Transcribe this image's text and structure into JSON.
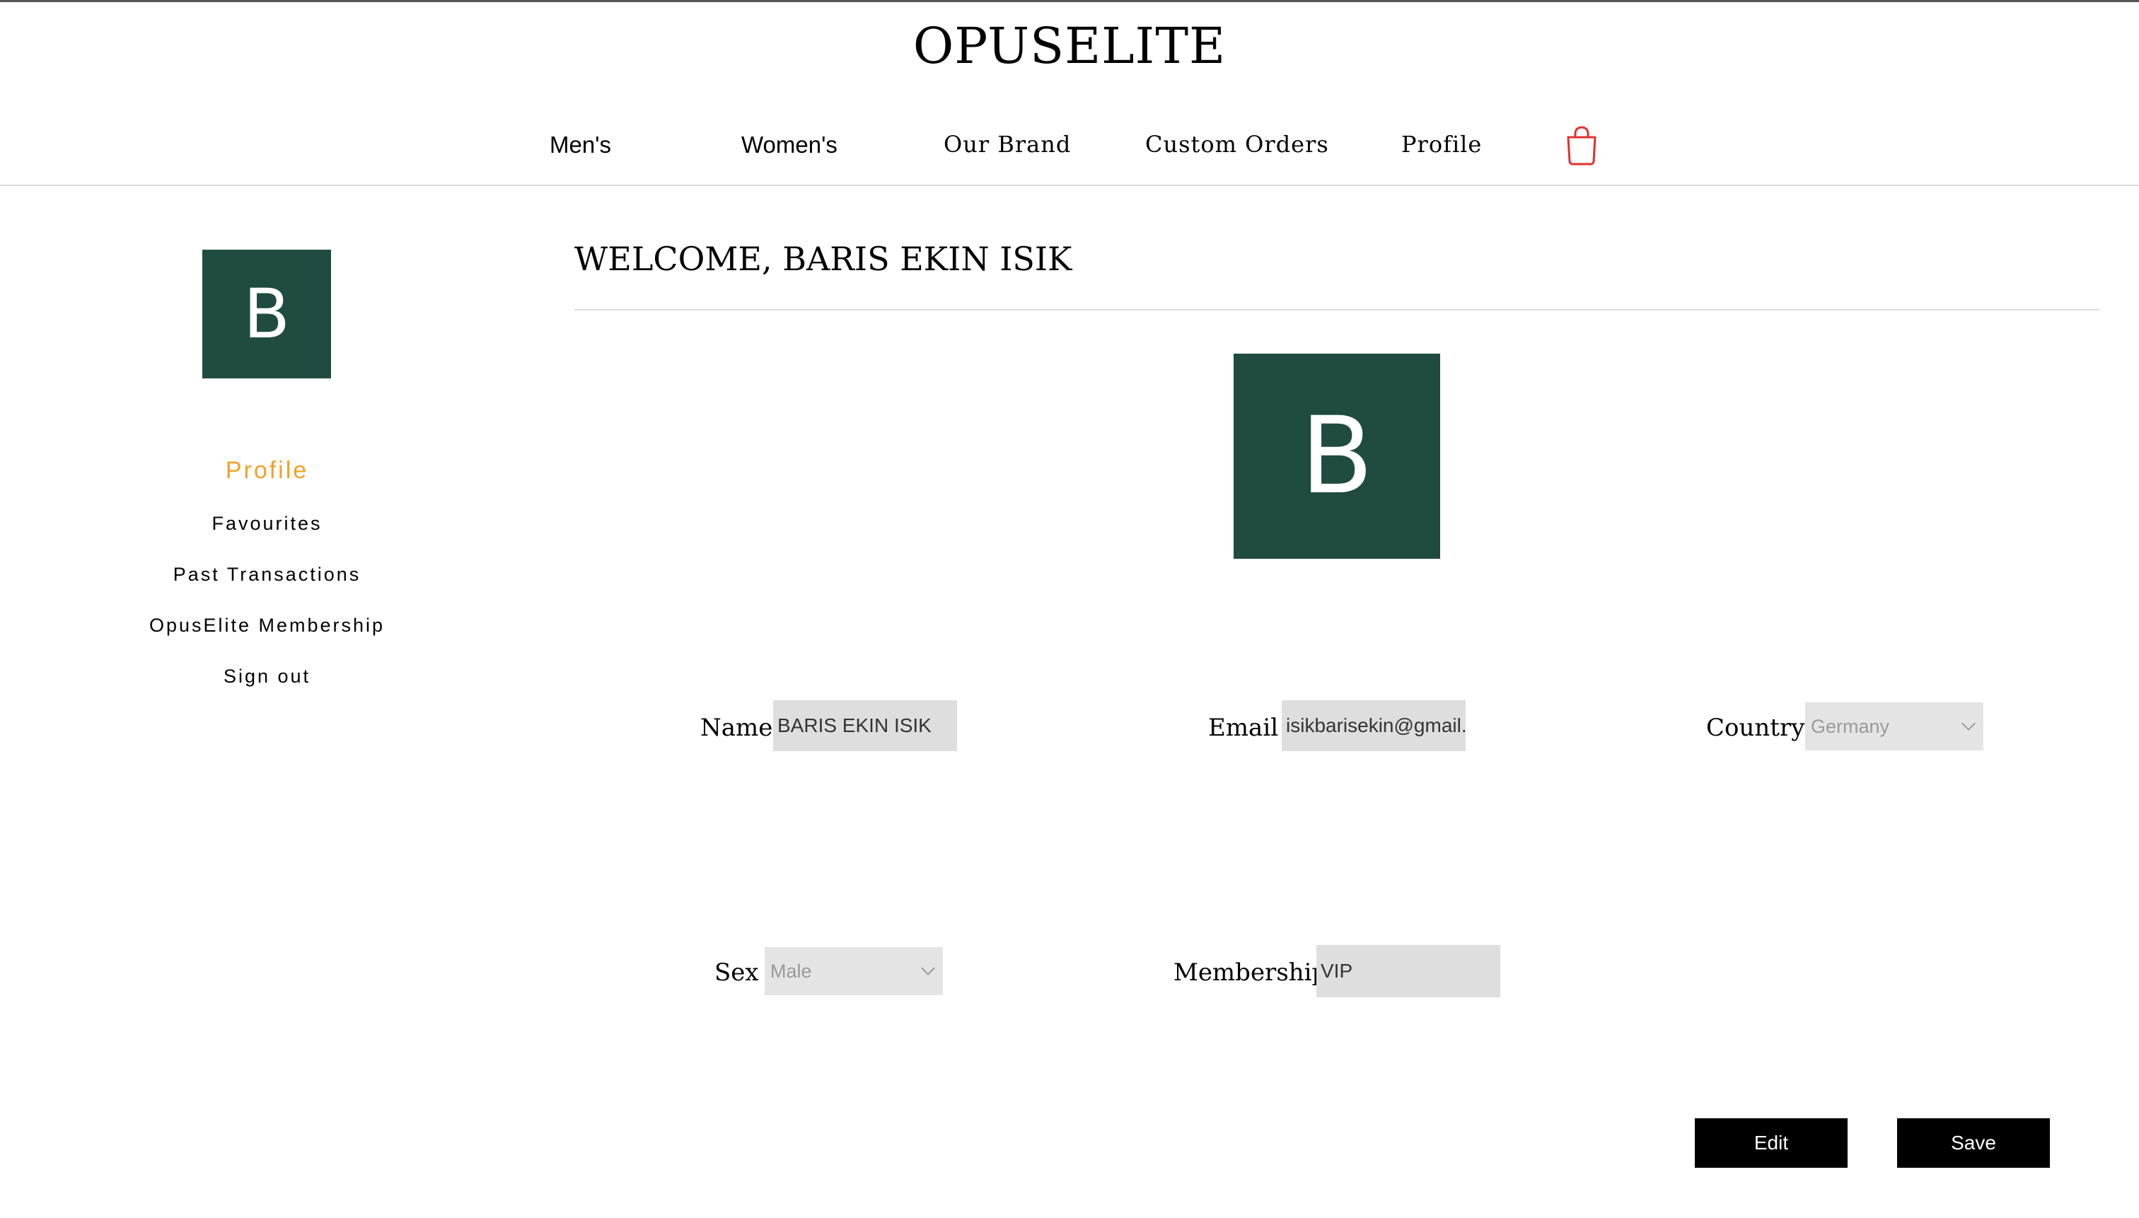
{
  "header": {
    "brand": "OPUSELITE",
    "nav": {
      "mens": "Men's",
      "womens": "Women's",
      "our_brand": "Our Brand",
      "custom_orders": "Custom Orders",
      "profile": "Profile"
    },
    "cart_icon": "shopping-bag-icon"
  },
  "sidebar": {
    "avatar_letter": "B",
    "items": [
      {
        "label": "Profile",
        "active": true
      },
      {
        "label": "Favourites"
      },
      {
        "label": "Past Transactions"
      },
      {
        "label": "OpusElite Membership"
      },
      {
        "label": "Sign out"
      }
    ]
  },
  "main": {
    "welcome": "WELCOME, BARIS EKIN ISIK",
    "avatar_letter": "B",
    "fields": {
      "name": {
        "label": "Name",
        "value": "BARIS EKIN ISIK"
      },
      "email": {
        "label": "Email",
        "value": "isikbarisekin@gmail.com"
      },
      "country": {
        "label": "Country",
        "value": "Germany"
      },
      "sex": {
        "label": "Sex",
        "value": "Male"
      },
      "membership": {
        "label": "Membership",
        "value": "VIP"
      }
    },
    "buttons": {
      "edit": "Edit",
      "save": "Save"
    }
  },
  "colors": {
    "avatar_bg": "#1f4b40",
    "active_link": "#f0a12a",
    "cart_icon": "#e0322f",
    "button_bg": "#000000"
  }
}
